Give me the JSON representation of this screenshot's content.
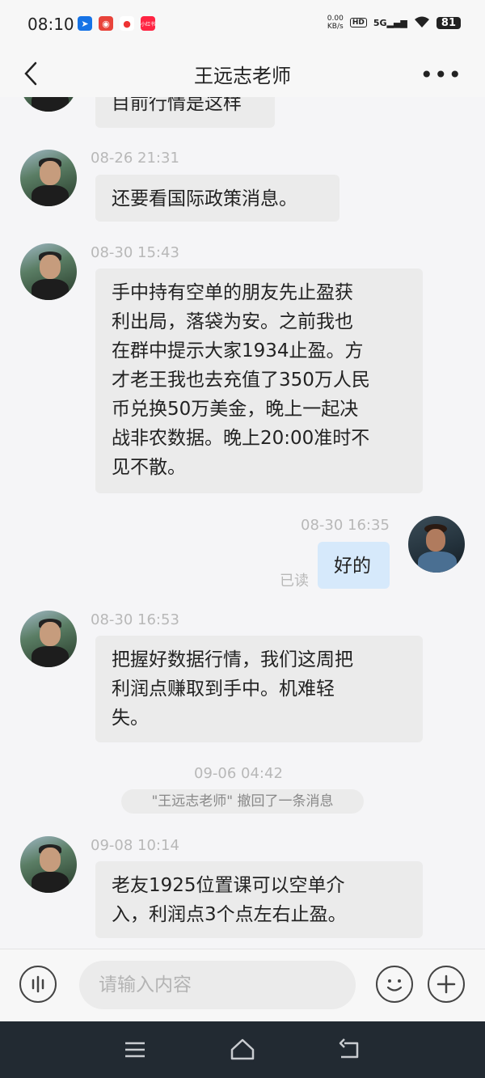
{
  "status_bar": {
    "time": "08:10",
    "net_speed_value": "0.00",
    "net_speed_unit": "KB/s",
    "hd": "HD",
    "network": "5G",
    "battery": "81",
    "app_icons": [
      "nav-app-icon",
      "game-app-icon",
      "browser-app-icon",
      "shop-app-icon"
    ],
    "shop_icon_text": "小红书"
  },
  "header": {
    "title": "王远志老师",
    "more": "•••"
  },
  "chat": {
    "top_partial_message": "目前行情是这样",
    "messages": [
      {
        "time": "08-26 21:31",
        "text": "还要看国际政策消息。"
      },
      {
        "time": "08-30 15:43",
        "lines": [
          "手中持有空单的朋友先止盈获",
          "利出局，落袋为安。之前我也",
          "在群中提示大家1934止盈。方",
          "才老王我也去充值了350万人民",
          "币兑换50万美金，晚上一起决",
          "战非农数据。晚上20:00准时不",
          "见不散。"
        ]
      },
      {
        "time": "08-30 16:35",
        "text": "好的",
        "read_status": "已读"
      },
      {
        "time": "08-30 16:53",
        "lines": [
          "把握好数据行情，我们这周把",
          "利润点赚取到手中。机难轻",
          "失。"
        ]
      },
      {
        "time": "09-06 04:42",
        "system": "\"王远志老师\" 撤回了一条消息"
      },
      {
        "time": "09-08 10:14",
        "lines": [
          "老友1925位置课可以空单介",
          "入，利润点3个点左右止盈。"
        ]
      }
    ]
  },
  "input_bar": {
    "placeholder": "请输入内容"
  },
  "colors": {
    "bubble_incoming": "#ebebeb",
    "bubble_outgoing": "#d6e9fb",
    "nav_bar": "#222a32"
  }
}
